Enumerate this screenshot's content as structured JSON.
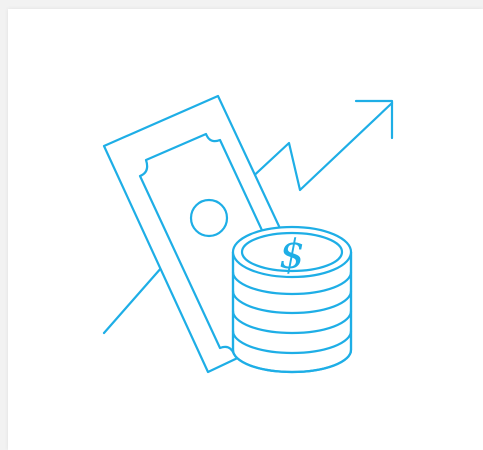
{
  "illustration": {
    "subject": "money-growth-icon",
    "accent_color": "#1eaee6",
    "background_color": "#ffffff",
    "icons": [
      "banknote-icon",
      "coin-stack-icon",
      "trend-arrow-icon",
      "dollar-sign-icon"
    ],
    "coin_symbol": "$"
  }
}
